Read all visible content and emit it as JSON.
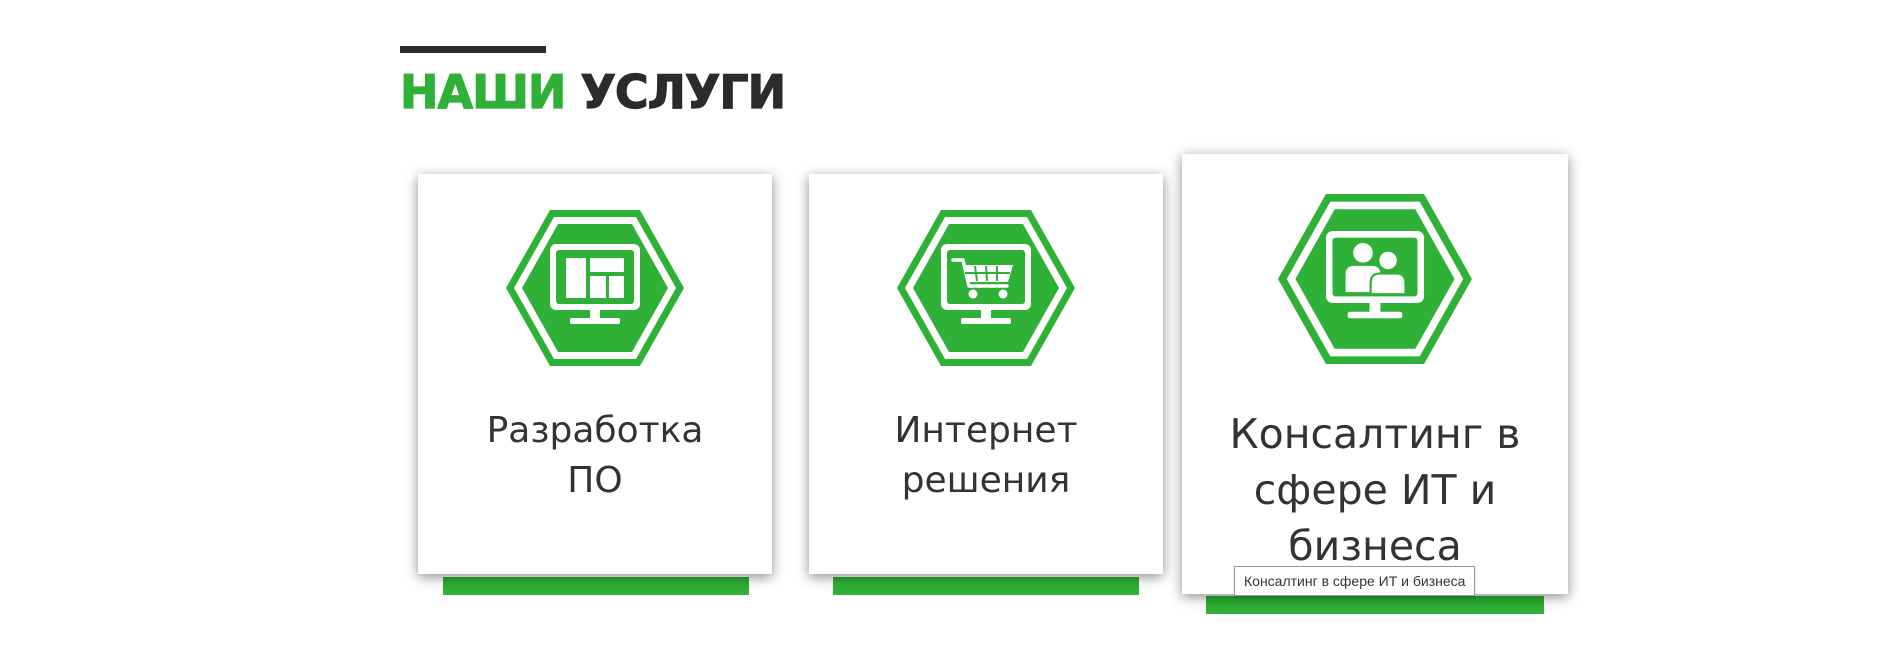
{
  "section": {
    "title_part1": "НАШИ",
    "title_part2": "УСЛУГИ"
  },
  "cards": [
    {
      "label": "Разработка\nПО",
      "icon": "it-monitor-icon"
    },
    {
      "label": "Интернет\nрешения",
      "icon": "shopping-cart-monitor-icon"
    },
    {
      "label": "Консалтинг в\nсфере ИТ и\nбизнеса",
      "icon": "people-monitor-icon"
    }
  ],
  "tooltip": {
    "text": "Консалтинг в сфере ИТ и бизнеса"
  },
  "colors": {
    "accent": "#2fb036",
    "dark": "#2b2b2b"
  }
}
